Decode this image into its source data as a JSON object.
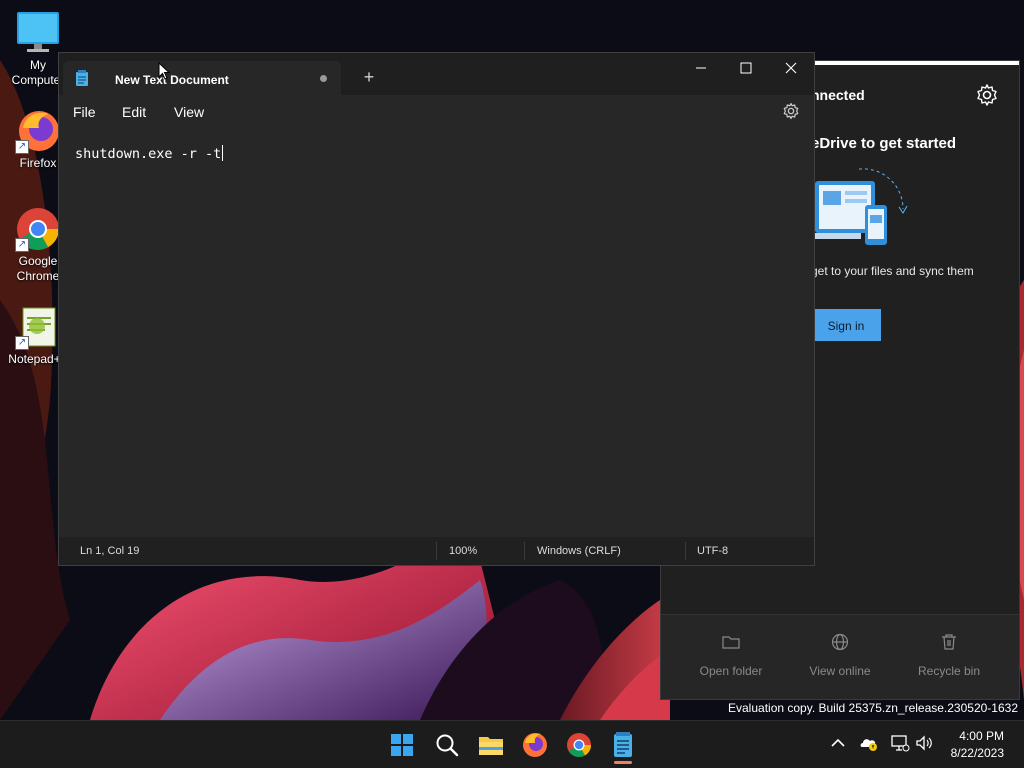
{
  "desktop": {
    "icons": [
      {
        "label": "My Computer",
        "icon": "monitor-icon"
      },
      {
        "label": "Firefox",
        "icon": "firefox-icon"
      },
      {
        "label": "Google Chrome",
        "icon": "chrome-icon"
      },
      {
        "label": "Notepad++",
        "icon": "notepadpp-icon"
      }
    ],
    "evaluation_text": "Evaluation copy. Build 25375.zn_release.230520-1632"
  },
  "onedrive": {
    "status": "nnected",
    "heading": "eDrive to get started",
    "description": "get to your files and sync them",
    "signin_label": "Sign in",
    "actions": [
      {
        "label": "Open folder",
        "icon": "folder-icon"
      },
      {
        "label": "View online",
        "icon": "globe-icon"
      },
      {
        "label": "Recycle bin",
        "icon": "trash-icon"
      }
    ]
  },
  "notepad": {
    "tab_title": "New Text Document",
    "new_tab_label": "+",
    "menu": {
      "file": "File",
      "edit": "Edit",
      "view": "View"
    },
    "content": "shutdown.exe -r -t",
    "status": {
      "position": "Ln 1, Col 19",
      "zoom": "100%",
      "line_ending": "Windows (CRLF)",
      "encoding": "UTF-8"
    }
  },
  "taskbar": {
    "apps": [
      "start-icon",
      "search-icon",
      "file-explorer-icon",
      "firefox-icon",
      "chrome-icon",
      "notepad-icon"
    ],
    "clock": {
      "time": "4:00 PM",
      "date": "8/22/2023"
    }
  },
  "colors": {
    "accent": "#4aa3ea",
    "window_bg": "#272727",
    "titlebar_bg": "#1f1f1f",
    "taskbar_bg": "#1c1c1c"
  }
}
